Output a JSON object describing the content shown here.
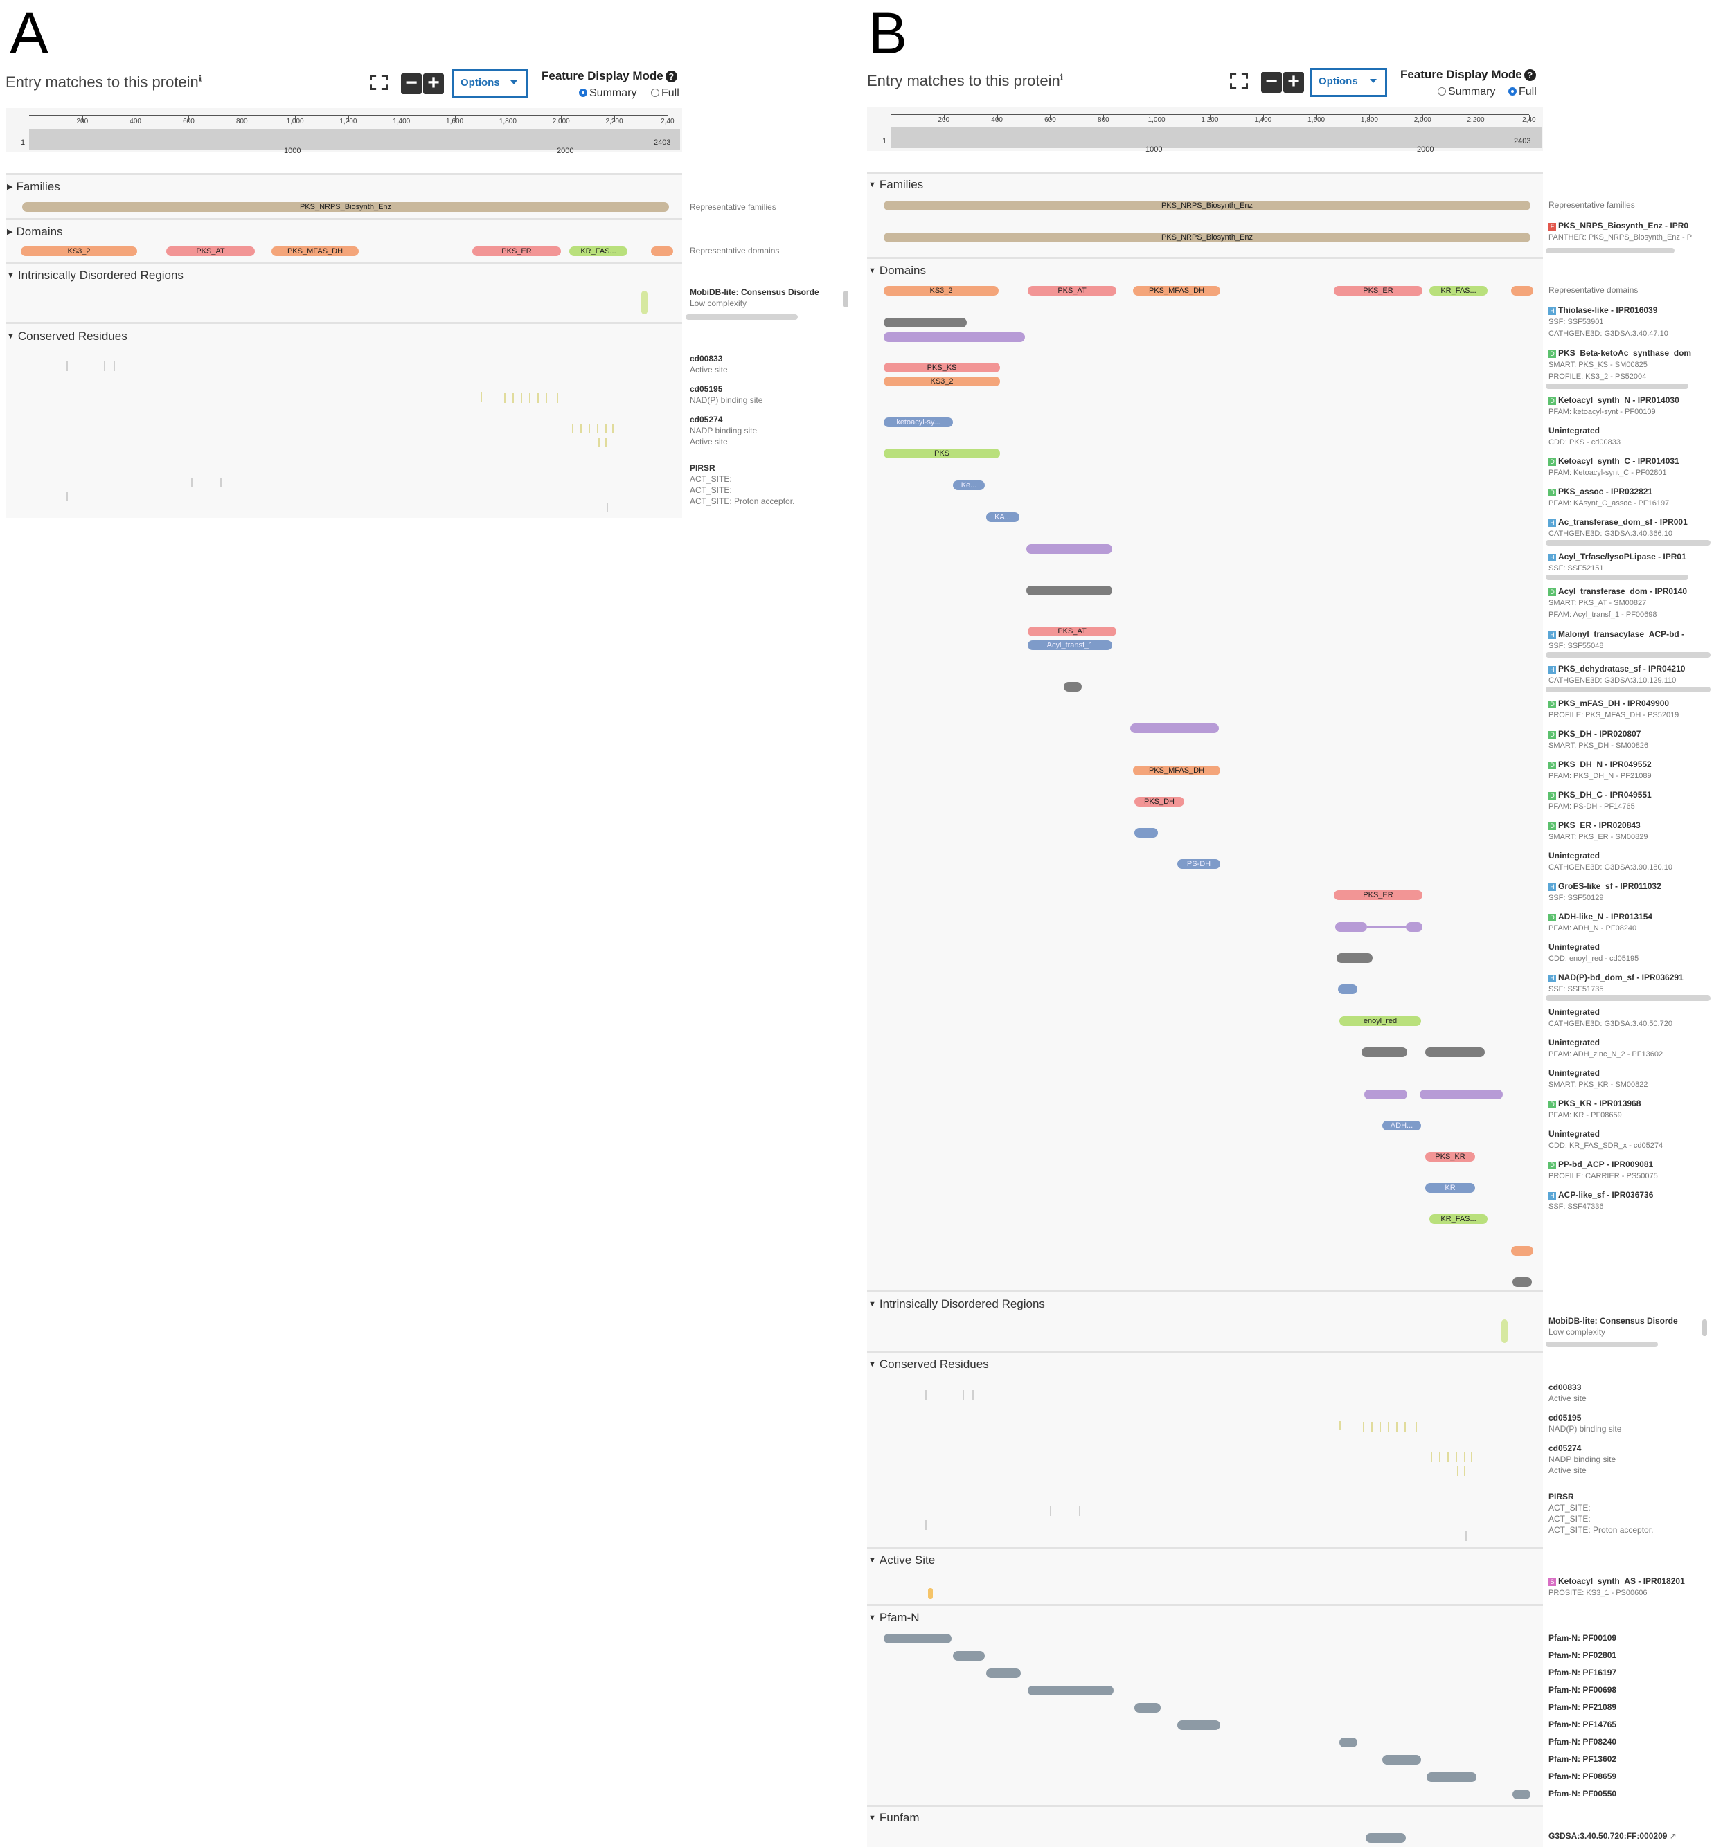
{
  "panelA": {
    "letter": "A",
    "header": {
      "title": "Entry matches to this protein",
      "title_info": "ℹ",
      "zoom_out": "−",
      "zoom_in": "+",
      "options_label": "Options",
      "feature_mode_label": "Feature Display Mode",
      "feature_mode_help": "?",
      "modes": [
        "Summary",
        "Full"
      ],
      "selected_mode": "Summary"
    },
    "ruler": {
      "ticks": [
        "200",
        "400",
        "600",
        "800",
        "1,000",
        "1,200",
        "1,400",
        "1,600",
        "1,800",
        "2,000",
        "2,200",
        "2,40"
      ],
      "start": "1",
      "end": "2403",
      "mid_labels": [
        "1000",
        "2000"
      ]
    },
    "sections": {
      "families": "Families",
      "domains": "Domains",
      "idr": "Intrinsically Disordered Regions",
      "conserved": "Conserved Residues"
    },
    "family_bar": "PKS_NRPS_Biosynth_Enz",
    "families_label": "Representative families",
    "domains_label": "Representative domains",
    "domain_bars": [
      "KS3_2",
      "PKS_AT",
      "PKS_MFAS_DH",
      "PKS_ER",
      "KR_FAS..."
    ],
    "idr_label": {
      "title": "MobiDB-lite: Consensus Disorde",
      "sub": "Low complexity"
    },
    "conserved_labels": [
      {
        "title": "cd00833",
        "lines": [
          "Active site"
        ]
      },
      {
        "title": "cd05195",
        "lines": [
          "NAD(P) binding site"
        ]
      },
      {
        "title": "cd05274",
        "lines": [
          "NADP binding site",
          "Active site"
        ]
      },
      {
        "title": "PIRSR",
        "lines": [
          "ACT_SITE:",
          "ACT_SITE:",
          "ACT_SITE: Proton acceptor."
        ]
      }
    ]
  },
  "panelB": {
    "letter": "B",
    "header": {
      "title": "Entry matches to this protein",
      "title_info": "ℹ",
      "zoom_out": "−",
      "zoom_in": "+",
      "options_label": "Options",
      "feature_mode_label": "Feature Display Mode",
      "feature_mode_help": "?",
      "modes": [
        "Summary",
        "Full"
      ],
      "selected_mode": "Full"
    },
    "ruler": {
      "ticks": [
        "200",
        "400",
        "600",
        "800",
        "1,000",
        "1,200",
        "1,400",
        "1,600",
        "1,800",
        "2,000",
        "2,200",
        "2,40"
      ],
      "start": "1",
      "end": "2403",
      "mid_labels": [
        "1000",
        "2000"
      ]
    },
    "sections": {
      "families": "Families",
      "domains": "Domains",
      "idr": "Intrinsically Disordered Regions",
      "conserved": "Conserved Residues",
      "active_site": "Active Site",
      "pfam_n": "Pfam-N",
      "funfam": "Funfam"
    },
    "family_bar": "PKS_NRPS_Biosynth_Enz",
    "families_label": "Representative families",
    "family_entry": {
      "badge": "F",
      "title": "PKS_NRPS_Biosynth_Enz - IPR0",
      "sub": "PANTHER: PKS_NRPS_Biosynth_Enz - P"
    },
    "domains_label": "Representative domains",
    "domain_bar_labels": [
      "KS3_2",
      "PKS_AT",
      "PKS_MFAS_DH",
      "PKS_ER",
      "KR_FAS...",
      "PKS_KS",
      "KS3_2",
      "ketoacyl-sy...",
      "PKS",
      "Ke...",
      "KA...",
      "PKS_AT",
      "Acyl_transf_1",
      "PKS_MFAS_DH",
      "PKS_DH",
      "PS-DH",
      "PKS_ER",
      "enoyl_red",
      "ADH...",
      "PKS_KR",
      "KR",
      "KR_FAS..."
    ],
    "domain_entries": [
      {
        "badge": "H",
        "title": "Thiolase-like - IPR016039",
        "lines": [
          "SSF: SSF53901",
          "CATHGENE3D: G3DSA:3.40.47.10"
        ]
      },
      {
        "badge": "D",
        "title": "PKS_Beta-ketoAc_synthase_dom",
        "lines": [
          "SMART: PKS_KS - SM00825",
          "PROFILE: KS3_2 - PS52004"
        ]
      },
      {
        "badge": "D",
        "title": "Ketoacyl_synth_N - IPR014030",
        "lines": [
          "PFAM: ketoacyl-synt - PF00109"
        ]
      },
      {
        "badge": "",
        "title": "Unintegrated",
        "lines": [
          "CDD: PKS - cd00833"
        ]
      },
      {
        "badge": "D",
        "title": "Ketoacyl_synth_C - IPR014031",
        "lines": [
          "PFAM: Ketoacyl-synt_C - PF02801"
        ]
      },
      {
        "badge": "D",
        "title": "PKS_assoc - IPR032821",
        "lines": [
          "PFAM: KAsynt_C_assoc - PF16197"
        ]
      },
      {
        "badge": "H",
        "title": "Ac_transferase_dom_sf - IPR001",
        "lines": [
          "CATHGENE3D: G3DSA:3.40.366.10"
        ]
      },
      {
        "badge": "H",
        "title": "Acyl_Trfase/lysoPLipase - IPR01",
        "lines": [
          "SSF: SSF52151"
        ]
      },
      {
        "badge": "D",
        "title": "Acyl_transferase_dom - IPR0140",
        "lines": [
          "SMART: PKS_AT - SM00827",
          "PFAM: Acyl_transf_1 - PF00698"
        ]
      },
      {
        "badge": "H",
        "title": "Malonyl_transacylase_ACP-bd -",
        "lines": [
          "SSF: SSF55048"
        ]
      },
      {
        "badge": "H",
        "title": "PKS_dehydratase_sf - IPR04210",
        "lines": [
          "CATHGENE3D: G3DSA:3.10.129.110"
        ]
      },
      {
        "badge": "D",
        "title": "PKS_mFAS_DH - IPR049900",
        "lines": [
          "PROFILE: PKS_MFAS_DH - PS52019"
        ]
      },
      {
        "badge": "D",
        "title": "PKS_DH - IPR020807",
        "lines": [
          "SMART: PKS_DH - SM00826"
        ]
      },
      {
        "badge": "D",
        "title": "PKS_DH_N - IPR049552",
        "lines": [
          "PFAM: PKS_DH_N - PF21089"
        ]
      },
      {
        "badge": "D",
        "title": "PKS_DH_C - IPR049551",
        "lines": [
          "PFAM: PS-DH - PF14765"
        ]
      },
      {
        "badge": "D",
        "title": "PKS_ER - IPR020843",
        "lines": [
          "SMART: PKS_ER - SM00829"
        ]
      },
      {
        "badge": "",
        "title": "Unintegrated",
        "lines": [
          "CATHGENE3D: G3DSA:3.90.180.10"
        ]
      },
      {
        "badge": "H",
        "title": "GroES-like_sf - IPR011032",
        "lines": [
          "SSF: SSF50129"
        ]
      },
      {
        "badge": "D",
        "title": "ADH-like_N - IPR013154",
        "lines": [
          "PFAM: ADH_N - PF08240"
        ]
      },
      {
        "badge": "",
        "title": "Unintegrated",
        "lines": [
          "CDD: enoyl_red - cd05195"
        ]
      },
      {
        "badge": "H",
        "title": "NAD(P)-bd_dom_sf - IPR036291",
        "lines": [
          "SSF: SSF51735"
        ]
      },
      {
        "badge": "",
        "title": "Unintegrated",
        "lines": [
          "CATHGENE3D: G3DSA:3.40.50.720"
        ]
      },
      {
        "badge": "",
        "title": "Unintegrated",
        "lines": [
          "PFAM: ADH_zinc_N_2 - PF13602"
        ]
      },
      {
        "badge": "",
        "title": "Unintegrated",
        "lines": [
          "SMART: PKS_KR - SM00822"
        ]
      },
      {
        "badge": "D",
        "title": "PKS_KR - IPR013968",
        "lines": [
          "PFAM: KR - PF08659"
        ]
      },
      {
        "badge": "",
        "title": "Unintegrated",
        "lines": [
          "CDD: KR_FAS_SDR_x - cd05274"
        ]
      },
      {
        "badge": "D",
        "title": "PP-bd_ACP - IPR009081",
        "lines": [
          "PROFILE: CARRIER - PS50075"
        ]
      },
      {
        "badge": "H",
        "title": "ACP-like_sf - IPR036736",
        "lines": [
          "SSF: SSF47336"
        ]
      }
    ],
    "idr_label": {
      "title": "MobiDB-lite: Consensus Disorde",
      "sub": "Low complexity"
    },
    "conserved_labels": [
      {
        "title": "cd00833",
        "lines": [
          "Active site"
        ]
      },
      {
        "title": "cd05195",
        "lines": [
          "NAD(P) binding site"
        ]
      },
      {
        "title": "cd05274",
        "lines": [
          "NADP binding site",
          "Active site"
        ]
      },
      {
        "title": "PIRSR",
        "lines": [
          "ACT_SITE:",
          "ACT_SITE:",
          "ACT_SITE: Proton acceptor."
        ]
      }
    ],
    "active_site_entry": {
      "badge": "S",
      "title": "Ketoacyl_synth_AS - IPR018201",
      "sub": "PROSITE: KS3_1 - PS00606"
    },
    "pfam_n_labels": [
      "Pfam-N: PF00109",
      "Pfam-N: PF02801",
      "Pfam-N: PF16197",
      "Pfam-N: PF00698",
      "Pfam-N: PF21089",
      "Pfam-N: PF14765",
      "Pfam-N: PF08240",
      "Pfam-N: PF13602",
      "Pfam-N: PF08659",
      "Pfam-N: PF00550"
    ],
    "funfam_label": "G3DSA:3.40.50.720:FF:000209"
  },
  "colors": {
    "family": "#c9b89c",
    "ks": "#f4a57a",
    "at": "#f29595",
    "dh": "#f4a57a",
    "er": "#f29595",
    "kr": "#b9e07c",
    "gray": "#7d7d7d",
    "purple": "#b79bd6",
    "blue": "#7e9bc9",
    "green": "#b9e07c",
    "pfam": "#8d9aa5",
    "accent": "#1f6fb5"
  }
}
